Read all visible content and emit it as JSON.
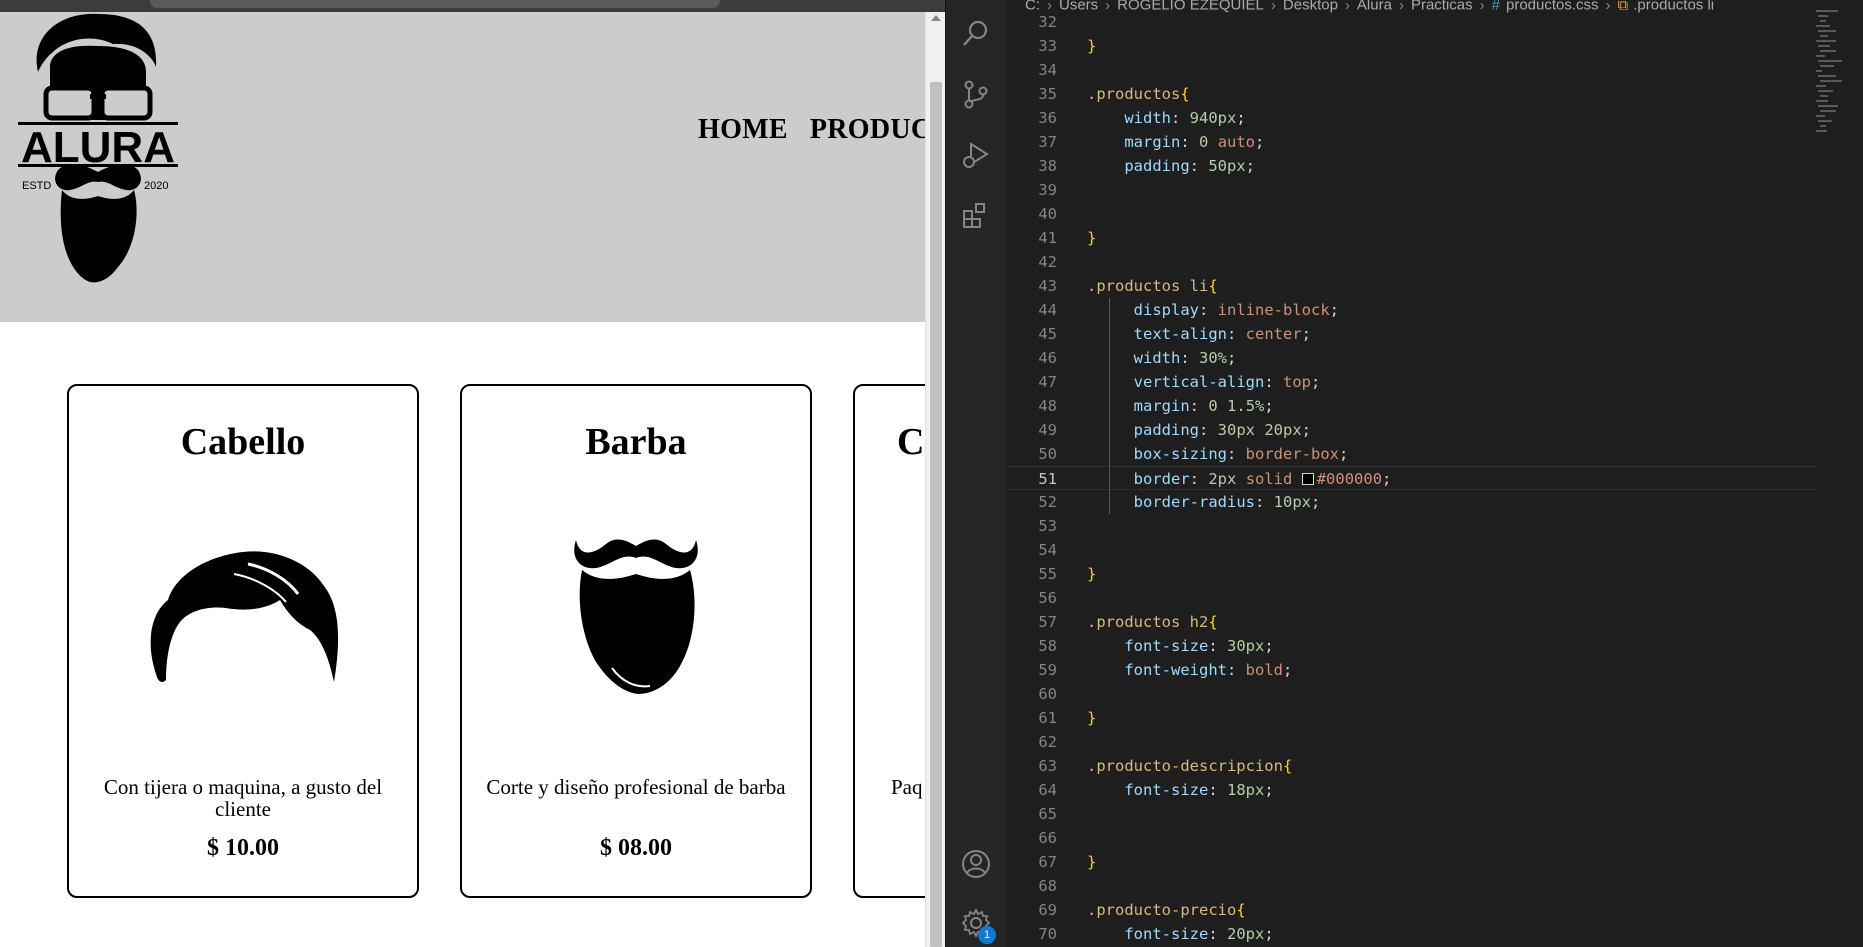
{
  "site": {
    "logo": {
      "brand": "ALURA",
      "est": "ESTD",
      "year": "2020"
    },
    "nav": [
      "HOME",
      "PRODUC"
    ],
    "products": [
      {
        "title": "Cabello",
        "image_icon": "hair-icon",
        "description": "Con tijera o maquina, a gusto del cliente",
        "price": "$ 10.00"
      },
      {
        "title": "Barba",
        "image_icon": "beard-icon",
        "description": "Corte y diseño profesional de barba",
        "price": "$ 08.00"
      },
      {
        "title": "C",
        "image_icon": "",
        "description": "Paq",
        "price": ""
      }
    ]
  },
  "vscode": {
    "breadcrumb": [
      "C:",
      "Users",
      "ROGELIO EZEQUIEL",
      "Desktop",
      "Alura",
      "Practicas",
      "productos.css",
      ".productos li"
    ],
    "active_line": 51,
    "notification_badge": "1",
    "code_lines": [
      {
        "n": "32",
        "t": ""
      },
      {
        "n": "33",
        "t": "}"
      },
      {
        "n": "34",
        "t": ""
      },
      {
        "n": "35",
        "t": ".productos{"
      },
      {
        "n": "36",
        "t": "    width: 940px;"
      },
      {
        "n": "37",
        "t": "    margin: 0 auto;"
      },
      {
        "n": "38",
        "t": "    padding: 50px;"
      },
      {
        "n": "39",
        "t": ""
      },
      {
        "n": "40",
        "t": ""
      },
      {
        "n": "41",
        "t": "}"
      },
      {
        "n": "42",
        "t": ""
      },
      {
        "n": "43",
        "t": ".productos li{"
      },
      {
        "n": "44",
        "t": "     display: inline-block;"
      },
      {
        "n": "45",
        "t": "     text-align: center;"
      },
      {
        "n": "46",
        "t": "     width: 30%;"
      },
      {
        "n": "47",
        "t": "     vertical-align: top;"
      },
      {
        "n": "48",
        "t": "     margin: 0 1.5%;"
      },
      {
        "n": "49",
        "t": "     padding: 30px 20px;"
      },
      {
        "n": "50",
        "t": "     box-sizing: border-box;"
      },
      {
        "n": "51",
        "t": "     border: 2px solid #000000;"
      },
      {
        "n": "52",
        "t": "     border-radius: 10px;"
      },
      {
        "n": "53",
        "t": ""
      },
      {
        "n": "54",
        "t": ""
      },
      {
        "n": "55",
        "t": "}"
      },
      {
        "n": "56",
        "t": ""
      },
      {
        "n": "57",
        "t": ".productos h2{"
      },
      {
        "n": "58",
        "t": "    font-size: 30px;"
      },
      {
        "n": "59",
        "t": "    font-weight: bold;"
      },
      {
        "n": "60",
        "t": ""
      },
      {
        "n": "61",
        "t": "}"
      },
      {
        "n": "62",
        "t": ""
      },
      {
        "n": "63",
        "t": ".producto-descripcion{"
      },
      {
        "n": "64",
        "t": "    font-size: 18px;"
      },
      {
        "n": "65",
        "t": ""
      },
      {
        "n": "66",
        "t": ""
      },
      {
        "n": "67",
        "t": "}"
      },
      {
        "n": "68",
        "t": ""
      },
      {
        "n": "69",
        "t": ".producto-precio{"
      },
      {
        "n": "70",
        "t": "    font-size: 20px;"
      }
    ],
    "colors": {
      "selector": "#d7ba7d",
      "brace": "#ffd700",
      "property": "#9cdcfe",
      "number": "#b5cea8",
      "keyword": "#ce9178",
      "editor_bg": "#1e1e1e",
      "activity_bg": "#252526"
    },
    "activity_icons": [
      "search-icon",
      "source-control-icon",
      "run-debug-icon",
      "extensions-icon",
      "account-icon",
      "settings-gear-icon"
    ]
  }
}
